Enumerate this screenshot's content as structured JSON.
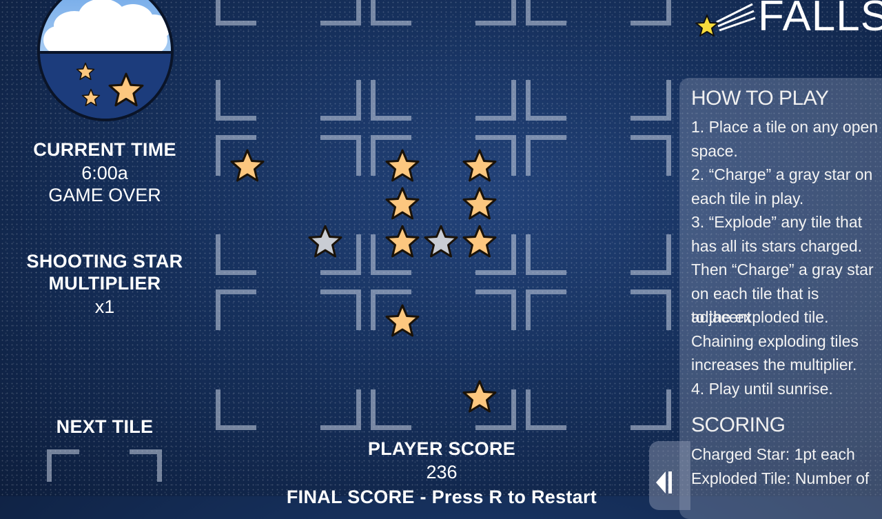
{
  "game": {
    "logo_text": "FALLS",
    "current_time_label": "CURRENT TIME",
    "current_time_value": "6:00a",
    "status": "GAME OVER",
    "multiplier_label_1": "SHOOTING STAR",
    "multiplier_label_2": "MULTIPLIER",
    "multiplier_value": "x1",
    "next_tile_label": "NEXT TILE",
    "player_score_label": "PLAYER SCORE",
    "player_score_value": "236",
    "final_score_text": "FINAL SCORE - Press R to Restart"
  },
  "how_to_play": {
    "title": "HOW TO PLAY",
    "lines": [
      "1. Place a tile on any open",
      "space.",
      "2. “Charge” a gray star on",
      "each tile in play.",
      "3. “Explode” any tile that",
      "has all its stars charged.",
      "Then “Charge” a gray star",
      "on each tile that is adjacent",
      "to the exploded tile.",
      "Chaining exploding tiles",
      "increases the multiplier.",
      "4. Play until sunrise."
    ]
  },
  "scoring": {
    "title": "SCORING",
    "lines": [
      "Charged Star: 1pt each",
      "Exploded Tile: Number of"
    ]
  },
  "colors": {
    "gold_star": "#fcc77f",
    "gray_star": "#c9cdd4",
    "star_outline": "#1a1208"
  }
}
